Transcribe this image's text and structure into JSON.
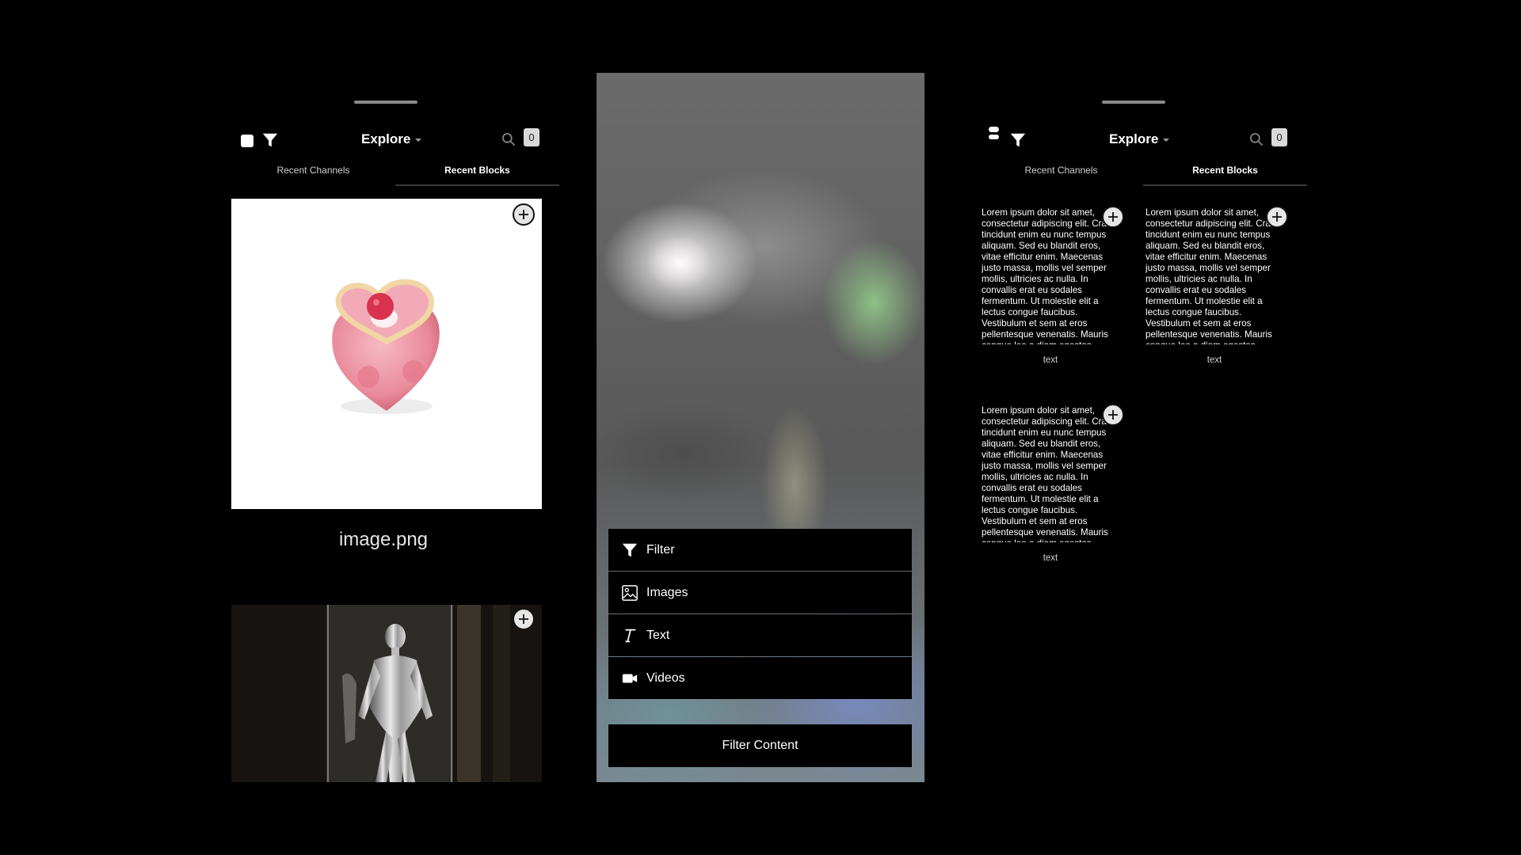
{
  "header": {
    "title": "Explore",
    "badge_count": "0"
  },
  "tabs": [
    {
      "label": "Recent Channels"
    },
    {
      "label": "Recent Blocks"
    }
  ],
  "left_screen": {
    "blocks": [
      {
        "type": "image",
        "caption": "image.png"
      },
      {
        "type": "image",
        "caption": ""
      }
    ]
  },
  "middle_screen": {
    "menu": [
      {
        "label": "Filter",
        "icon": "filter-icon"
      },
      {
        "label": "Images",
        "icon": "image-icon"
      },
      {
        "label": "Text",
        "icon": "text-icon"
      },
      {
        "label": "Videos",
        "icon": "video-icon"
      }
    ],
    "action_label": "Filter Content"
  },
  "right_screen": {
    "blocks": [
      {
        "body": "Lorem ipsum dolor sit amet, consectetur adipiscing elit. Cras tincidunt enim eu nunc tempus aliquam. Sed eu blandit eros, vitae efficitur enim. Maecenas justo massa, mollis vel semper mollis, ultricies ac nulla. In convallis erat eu sodales fermentum. Ut molestie elit a lectus congue faucibus. Vestibulum et sem at eros pellentesque venenatis. Mauris congue leo a diam egestas",
        "kind": "text"
      },
      {
        "body": "Lorem ipsum dolor sit amet, consectetur adipiscing elit. Cras tincidunt enim eu nunc tempus aliquam. Sed eu blandit eros, vitae efficitur enim. Maecenas justo massa, mollis vel semper mollis, ultricies ac nulla. In convallis erat eu sodales fermentum. Ut molestie elit a lectus congue faucibus. Vestibulum et sem at eros pellentesque venenatis. Mauris congue leo a diam egestas",
        "kind": "text"
      },
      {
        "body": "Lorem ipsum dolor sit amet, consectetur adipiscing elit. Cras tincidunt enim eu nunc tempus aliquam. Sed eu blandit eros, vitae efficitur enim. Maecenas justo massa, mollis vel semper mollis, ultricies ac nulla. In convallis erat eu sodales fermentum. Ut molestie elit a lectus congue faucibus. Vestibulum et sem at eros pellentesque venenatis. Mauris congue leo a diam egestas",
        "kind": "text"
      }
    ]
  },
  "colors": {
    "background": "#000000",
    "badge": "#d9d9d9",
    "tab_underline": "#3a3a3a"
  }
}
